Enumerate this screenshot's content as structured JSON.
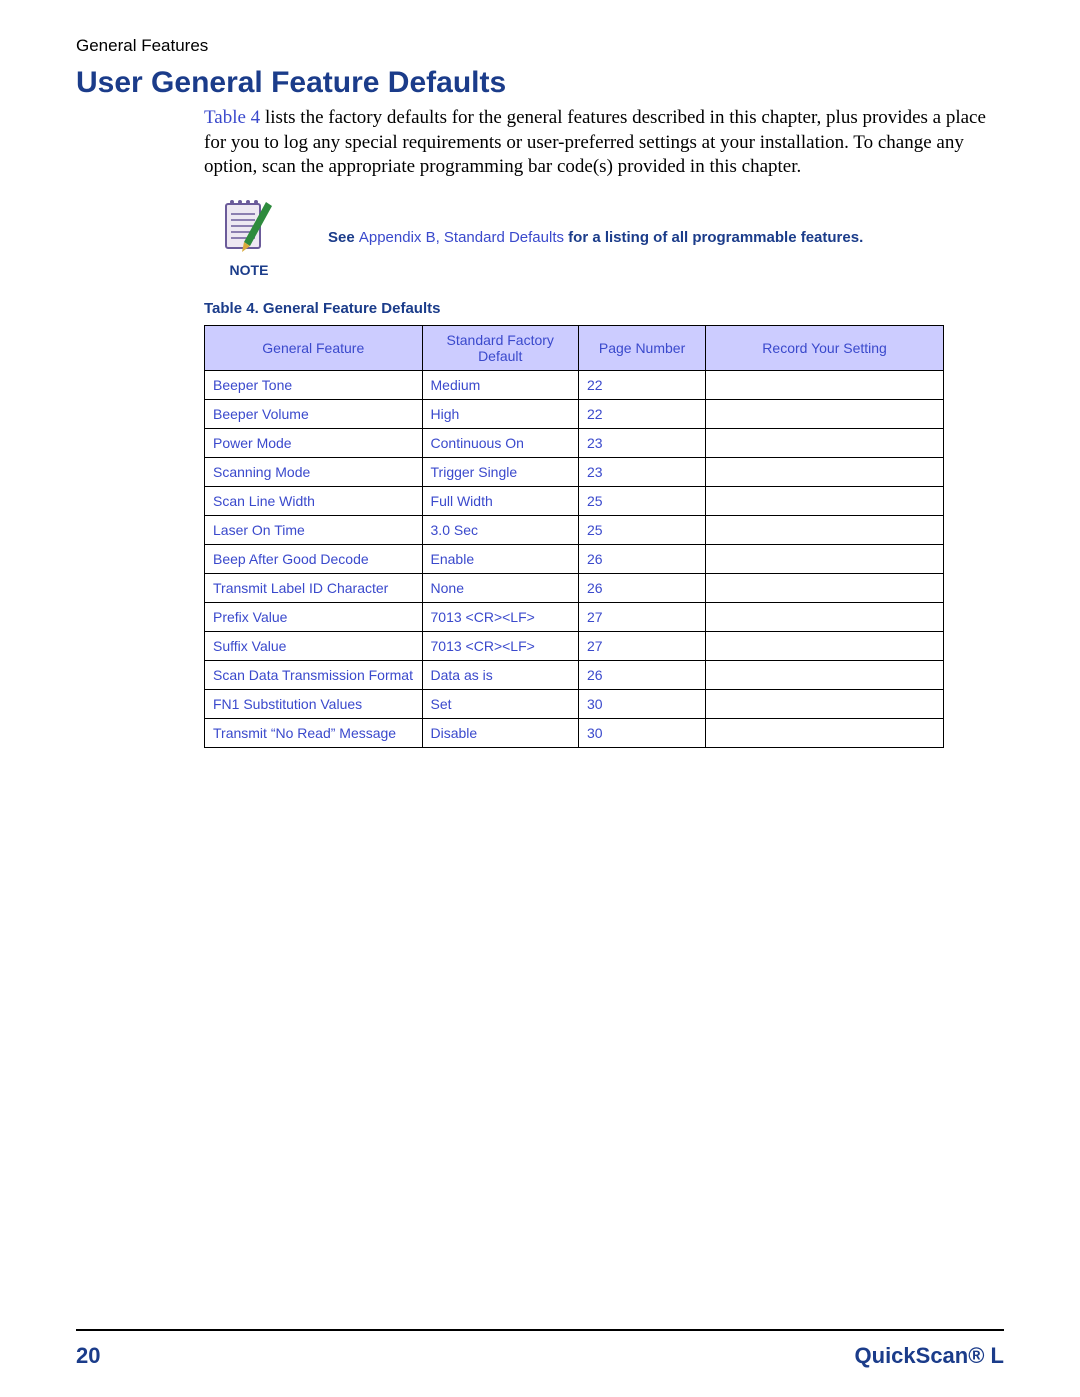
{
  "header": {
    "running": "General Features"
  },
  "title": "User General Feature Defaults",
  "intro": {
    "link": "Table 4",
    "rest": " lists the factory defaults for the general features described in this chapter, plus provides a place for you to log any special requirements or user-preferred settings at your installation. To change any option, scan the appropriate programming bar code(s) provided in this chapter."
  },
  "note": {
    "icon": "notepad-icon",
    "label": "NOTE",
    "pre": "See ",
    "link": "Appendix B, Standard Defaults",
    "post": " for a listing of all programmable features."
  },
  "table": {
    "caption": "Table 4. General Feature Defaults",
    "headers": [
      "General Feature",
      "Standard Factory Default",
      "Page Number",
      "Record Your Setting"
    ],
    "rows": [
      {
        "feature": "Beeper Tone",
        "default": "Medium",
        "page": "22",
        "record": ""
      },
      {
        "feature": "Beeper Volume",
        "default": "High",
        "page": "22",
        "record": ""
      },
      {
        "feature": "Power Mode",
        "default": "Continuous On",
        "page": "23",
        "record": ""
      },
      {
        "feature": "Scanning Mode",
        "default": "Trigger Single",
        "page": "23",
        "record": ""
      },
      {
        "feature": "Scan Line Width",
        "default": "Full Width",
        "page": "25",
        "record": ""
      },
      {
        "feature": "Laser On Time",
        "default": "3.0 Sec",
        "page": "25",
        "record": ""
      },
      {
        "feature": "Beep After Good Decode",
        "default": "Enable",
        "page": "26",
        "record": ""
      },
      {
        "feature": "Transmit Label ID Character",
        "default": "None",
        "page": "26",
        "record": ""
      },
      {
        "feature": "Prefix Value",
        "default": "7013 <CR><LF>",
        "page": "27",
        "record": ""
      },
      {
        "feature": "Suffix Value",
        "default": "7013 <CR><LF>",
        "page": "27",
        "record": ""
      },
      {
        "feature": "Scan Data Transmission Format",
        "default": "Data as is",
        "page": "26",
        "record": ""
      },
      {
        "feature": "FN1 Substitution Values",
        "default": "Set",
        "page": "30",
        "record": ""
      },
      {
        "feature": "Transmit “No Read” Message",
        "default": "Disable",
        "page": "30",
        "record": ""
      }
    ]
  },
  "footer": {
    "page": "20",
    "product": "QuickScan® L"
  }
}
